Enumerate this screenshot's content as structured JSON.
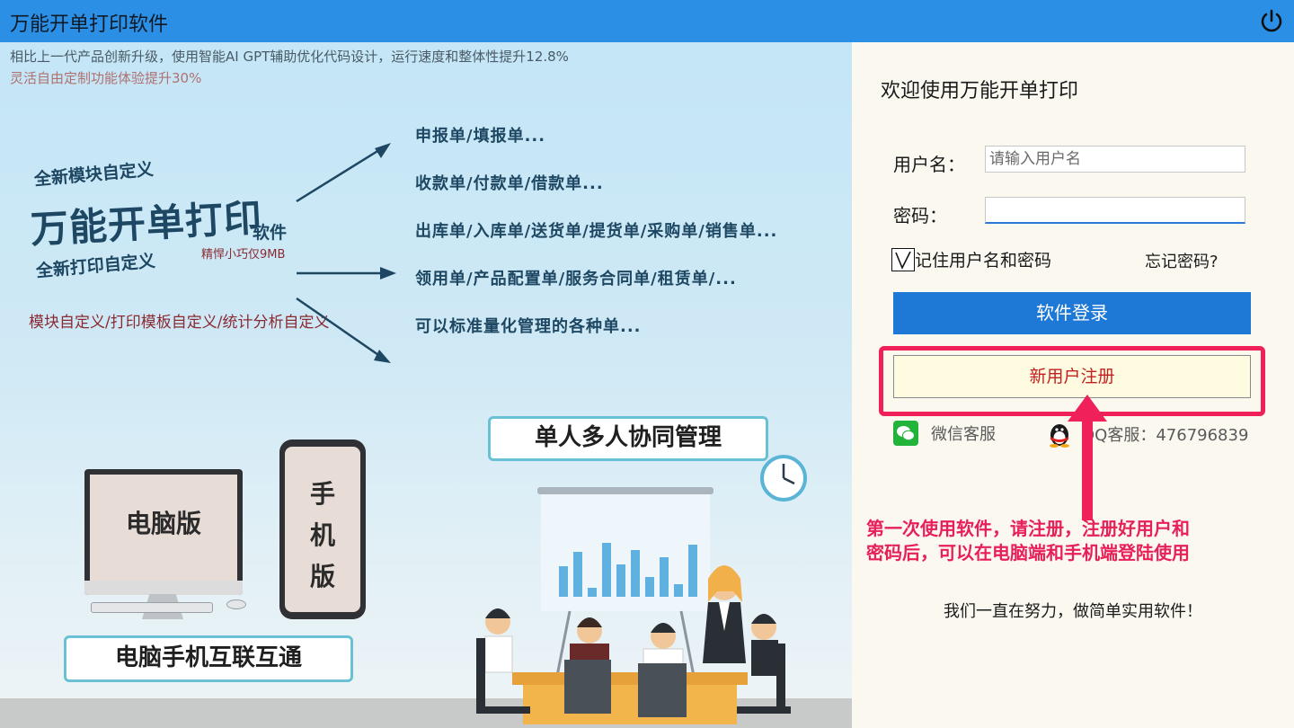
{
  "window": {
    "title": "万能开单打印软件",
    "power_icon": "power-icon"
  },
  "banner": {
    "info_line1": "相比上一代产品创新升级，使用智能AI GPT辅助优化代码设计，运行速度和整体性提升12.8%",
    "info_line2": "灵活自由定制功能体验提升30%",
    "feature_module": "全新模块自定义",
    "product_name": "万能开单打印",
    "product_suffix": "软件",
    "size_note": "精悍小巧仅9MB",
    "feature_print": "全新打印自定义",
    "custom_line": "模块自定义/打印模板自定义/统计分析自定义",
    "form_types": [
      "申报单/填报单...",
      "收款单/付款单/借款单...",
      "出库单/入库单/送货单/提货单/采购单/销售单...",
      "领用单/产品配置单/服务合同单/租赁单/...",
      "可以标准量化管理的各种单..."
    ],
    "pc_label": "电脑版",
    "phone_label": "手机版",
    "connect_label": "电脑手机互联互通",
    "collab_label": "单人多人协同管理"
  },
  "login": {
    "welcome": "欢迎使用万能开单打印",
    "username_label": "用户名：",
    "username_placeholder": "请输入用户名",
    "username_value": "",
    "password_label": "密码：",
    "password_value": "",
    "remember_checked": true,
    "remember_label": "记住用户名和密码",
    "forgot_label": "忘记密码?",
    "login_button": "软件登录",
    "register_button": "新用户注册",
    "wechat_label": "微信客服",
    "qq_label": "QQ客服：476796839",
    "note_line1": "第一次使用软件，请注册，注册好用户和",
    "note_line2": "密码后，可以在电脑端和手机端登陆使用",
    "slogan": "我们一直在努力，做简单实用软件！"
  },
  "colors": {
    "titlebar": "#2b8fe6",
    "login_button": "#1e78d6",
    "highlight": "#f0205a",
    "register_text": "#c02020"
  }
}
